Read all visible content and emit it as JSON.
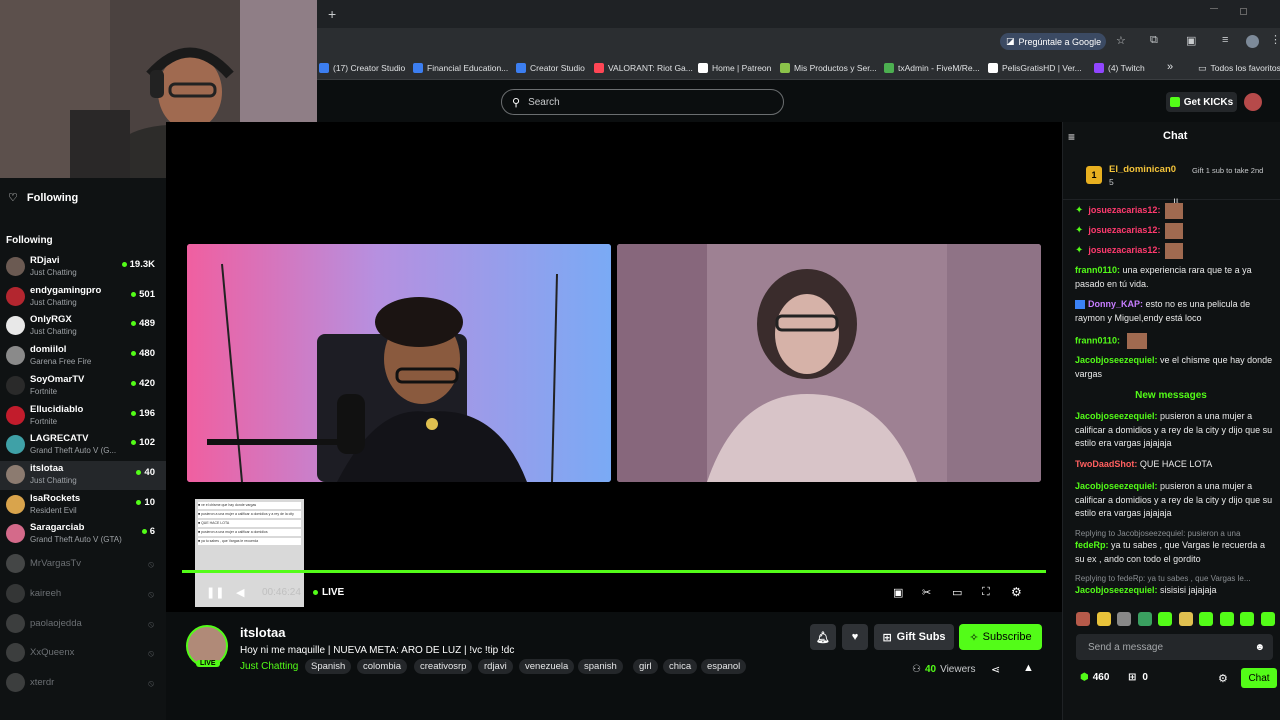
{
  "browser": {
    "new_tab": "+",
    "gemini_label": "Pregúntale a Google",
    "bookmarks": [
      {
        "label": "(17) Creator Studio",
        "color": "#3c7ef0"
      },
      {
        "label": "Financial Education...",
        "color": "#3c7ef0"
      },
      {
        "label": "Creator Studio",
        "color": "#3c7ef0"
      },
      {
        "label": "VALORANT: Riot Ga...",
        "color": "#ff4655"
      },
      {
        "label": "Home | Patreon",
        "color": "#ffffff"
      },
      {
        "label": "Mis Productos y Ser...",
        "color": "#8bc34a"
      },
      {
        "label": "txAdmin - FiveM/Re...",
        "color": "#4caf50"
      },
      {
        "label": "PelisGratisHD | Ver...",
        "color": "#ffffff"
      },
      {
        "label": "(4) Twitch",
        "color": "#9146ff"
      }
    ],
    "more_bookmarks": "»",
    "all_favorites": "Todos los favoritos"
  },
  "site": {
    "search_placeholder": "Search",
    "get_kicks": "Get KICKs",
    "brand_color": "#53fc18"
  },
  "sidebar": {
    "header": "Following",
    "section": "Following",
    "channels": [
      {
        "name": "RDjavi",
        "category": "Just Chatting",
        "viewers": "19.3K",
        "color": "#6b5a52"
      },
      {
        "name": "endygamingpro",
        "category": "Just Chatting",
        "viewers": "501",
        "color": "#b3262f"
      },
      {
        "name": "OnlyRGX",
        "category": "Just Chatting",
        "viewers": "489",
        "color": "#e8e8e8"
      },
      {
        "name": "domiilol",
        "category": "Garena Free Fire",
        "viewers": "480",
        "color": "#8a8a8a"
      },
      {
        "name": "SoyOmarTV",
        "category": "Fortnite",
        "viewers": "420",
        "color": "#2a2a2a"
      },
      {
        "name": "Ellucidiablo",
        "category": "Fortnite",
        "viewers": "196",
        "color": "#c21c2c"
      },
      {
        "name": "LAGRECATV",
        "category": "Grand Theft Auto V (G...",
        "viewers": "102",
        "color": "#3fa1a7"
      },
      {
        "name": "itslotaa",
        "category": "Just Chatting",
        "viewers": "40",
        "color": "#8c7b70"
      },
      {
        "name": "IsaRockets",
        "category": "Resident Evil",
        "viewers": "10",
        "color": "#d9a44c"
      },
      {
        "name": "Saragarciab",
        "category": "Grand Theft Auto V (GTA)",
        "viewers": "6",
        "color": "#d46a8a"
      }
    ],
    "offline": [
      {
        "name": "MrVargasTv",
        "color": "#7a7a7a"
      },
      {
        "name": "kaireeh",
        "color": "#5a5a5a"
      },
      {
        "name": "paolaojedda",
        "color": "#6a6a6a"
      },
      {
        "name": "XxQueenx",
        "color": "#6a6a6a"
      },
      {
        "name": "xterdr",
        "color": "#6a6a6a"
      }
    ]
  },
  "player": {
    "time": "00:46:24",
    "live": "LIVE"
  },
  "stream": {
    "channel": "itslotaa",
    "live_badge": "LIVE",
    "title": "Hoy ni me maquille | NUEVA META: ARO DE LUZ | !vc !tip !dc",
    "category": "Just Chatting",
    "tags": [
      "Spanish",
      "colombia",
      "creativosrp",
      "rdjavi",
      "venezuela",
      "spanish",
      "girl",
      "chica",
      "espanol"
    ],
    "gift_subs": "Gift Subs",
    "subscribe": "Subscribe",
    "viewers_count": "40",
    "viewers_label": "Viewers"
  },
  "chat": {
    "title": "Chat",
    "top_gifter": {
      "rank": "1",
      "name": "El_dominican0",
      "count": "5",
      "note": "Gift 1 sub to take 2nd"
    },
    "emote_users": [
      "josuezacarias12:",
      "josuezacarias12:",
      "josuezacarias12:"
    ],
    "messages_before": [
      {
        "user": "frann0110:",
        "text": "una experiencia rara que te a ya pasado en tú vida.",
        "color": "#53fc18"
      },
      {
        "user": "Donny_KAP:",
        "text": "esto no es una pelicula de raymon y Miguel,endy está loco",
        "color": "#c77dff"
      },
      {
        "user": "frann0110:",
        "text": "",
        "color": "#53fc18"
      },
      {
        "user": "Jacobjoseezequiel:",
        "text": "ve el chisme que hay donde vargas",
        "color": "#53fc18"
      }
    ],
    "new_messages": "New messages",
    "messages_after": [
      {
        "user": "Jacobjoseezequiel:",
        "text": "pusieron a una mujer a calificar a domidios y a rey de la city y dijo que su estilo era vargas jajajaja",
        "color": "#53fc18"
      },
      {
        "user": "TwoDaadShot:",
        "text": "QUE HACE LOTA",
        "color": "#ff5f5f"
      },
      {
        "user": "Jacobjoseezequiel:",
        "text": "pusieron a una mujer a calificar a domidios y a rey de la city y dijo que su estilo era vargas jajajaja",
        "color": "#53fc18"
      }
    ],
    "reply1": "Replying to Jacobjoseezequiel: pusieron a una",
    "reply1_msg": {
      "user": "fedeRp:",
      "text": "ya tu sabes , que Vargas le recuerda a su ex , ando con todo el gordito",
      "color": "#53fc18"
    },
    "reply2": "Replying to fedeRp: ya tu sabes , que Vargas le...",
    "reply2_msg": {
      "user": "Jacobjoseezequiel:",
      "text": "sisisisi jajajaja",
      "color": "#53fc18"
    },
    "send_placeholder": "Send a message",
    "points": "460",
    "gifts": "0",
    "chat_button": "Chat"
  }
}
